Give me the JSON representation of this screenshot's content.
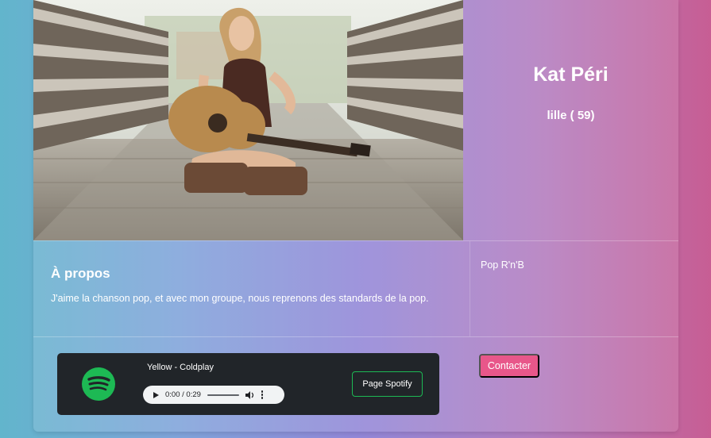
{
  "profile": {
    "photo_alt": "Woman sitting with acoustic guitar on a wooden bridge",
    "name": "Kat Péri",
    "city_age": "lille ( 59)"
  },
  "about": {
    "title": "À propos",
    "text": "J'aime la chanson pop, et avec mon groupe, nous reprenons des standards de la pop.",
    "genres": "Pop R'n'B"
  },
  "player": {
    "track": "Yellow - Coldplay",
    "time": "0:00 / 0:29",
    "spotify_label": "Page Spotify",
    "spotify_color": "#1db954",
    "progress": 0
  },
  "actions": {
    "contact_label": "Contacter",
    "contact_color": "#e8578a"
  }
}
